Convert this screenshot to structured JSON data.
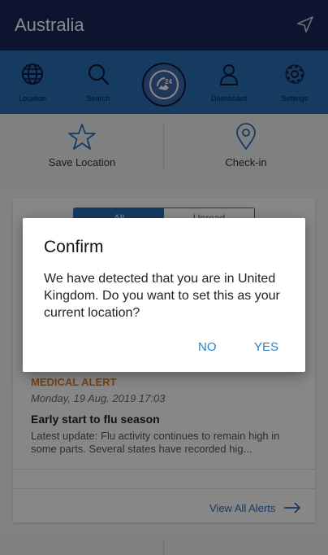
{
  "topbar": {
    "title": "Australia",
    "locate_icon": "navigation-arrow-icon"
  },
  "nav": {
    "items": [
      {
        "label": "Location",
        "icon": "globe-icon"
      },
      {
        "label": "Search",
        "icon": "search-icon"
      },
      {
        "label": "Dashboard",
        "icon": "person-icon"
      },
      {
        "label": "Settings",
        "icon": "gear-icon"
      }
    ],
    "center_icon": "24-hour-phone-icon"
  },
  "actions": [
    {
      "label": "Save Location",
      "icon": "star-icon"
    },
    {
      "label": "Check-in",
      "icon": "map-pin-icon"
    }
  ],
  "alerts": {
    "segments": [
      "All",
      "Unread"
    ],
    "item": {
      "type": "MEDICAL ALERT",
      "date": "Monday, 19 Aug. 2019 17:03",
      "headline": "Early start to flu season",
      "body": "Latest update: Flu activity continues to remain high in some parts. Several states have recorded hig..."
    },
    "view_all": "View All Alerts"
  },
  "dialog": {
    "title": "Confirm",
    "message": "We have detected that you are in United Kingdom. Do you want to set this as your current location?",
    "no_label": "NO",
    "yes_label": "YES"
  },
  "colors": {
    "topbar": "#1a2658",
    "navbar": "#2a6db3",
    "accent": "#2a7fc2",
    "alert_type": "#e07b1b"
  }
}
